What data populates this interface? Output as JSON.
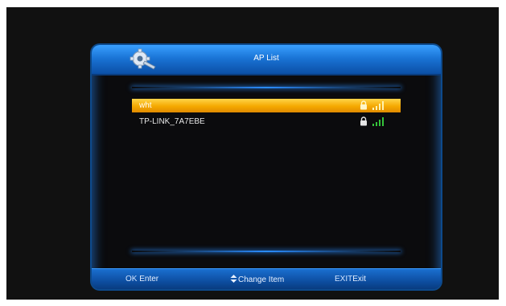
{
  "header": {
    "title": "AP List",
    "icon": "gear-wrench-icon"
  },
  "ap_list": [
    {
      "name": "wht",
      "selected": true,
      "locked": true,
      "signal": 4
    },
    {
      "name": "TP-LINK_7A7EBE",
      "selected": false,
      "locked": true,
      "signal": 4
    }
  ],
  "footer": {
    "ok_key": "OK",
    "ok_label": "Enter",
    "change_label": "Change Item",
    "exit_key": "EXIT",
    "exit_label": "Exit"
  },
  "colors": {
    "header_blue": "#1a74d6",
    "highlight": "#f5a800",
    "signal_green": "#35c43a"
  }
}
